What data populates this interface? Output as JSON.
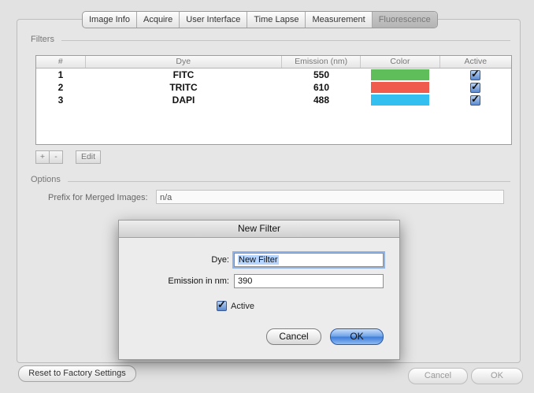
{
  "tabs": [
    {
      "label": "Image Info",
      "active": false
    },
    {
      "label": "Acquire",
      "active": false
    },
    {
      "label": "User Interface",
      "active": false
    },
    {
      "label": "Time Lapse",
      "active": false
    },
    {
      "label": "Measurement",
      "active": false
    },
    {
      "label": "Fluorescence",
      "active": true
    }
  ],
  "filters": {
    "group_label": "Filters",
    "columns": [
      "#",
      "Dye",
      "Emission (nm)",
      "Color",
      "Active"
    ],
    "rows": [
      {
        "num": "1",
        "dye": "FITC",
        "emission": "550",
        "color": "#5fbe5a",
        "active": true
      },
      {
        "num": "2",
        "dye": "TRITC",
        "emission": "610",
        "color": "#ef5c4d",
        "active": true
      },
      {
        "num": "3",
        "dye": "DAPI",
        "emission": "488",
        "color": "#33bff0",
        "active": true
      }
    ],
    "add_label": "+",
    "remove_label": "-",
    "edit_label": "Edit"
  },
  "options": {
    "group_label": "Options",
    "prefix_label": "Prefix for Merged Images:",
    "prefix_value": "n/a"
  },
  "footer": {
    "reset_label": "Reset to Factory Settings",
    "cancel_label": "Cancel",
    "ok_label": "OK"
  },
  "dialog": {
    "title": "New Filter",
    "dye_label": "Dye:",
    "dye_value": "New Filter",
    "emission_label": "Emission in nm:",
    "emission_value": "390",
    "active_label": "Active",
    "active_checked": true,
    "cancel_label": "Cancel",
    "ok_label": "OK"
  }
}
